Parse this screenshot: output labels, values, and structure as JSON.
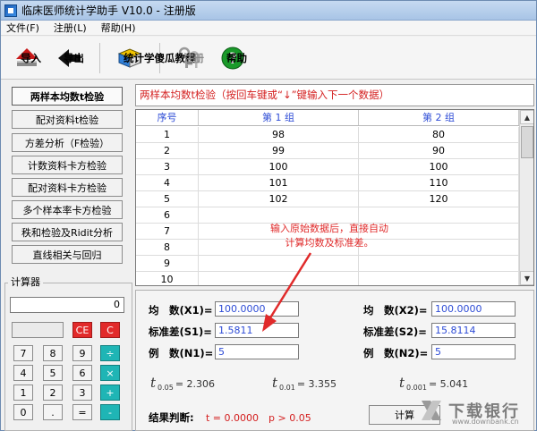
{
  "window": {
    "title": "临床医师统计学助手 V10.0 - 注册版"
  },
  "menu": {
    "file": "文件(F)",
    "register": "注册(L)",
    "help": "帮助(H)"
  },
  "toolbar": {
    "import": "导入",
    "export": "导出",
    "tutorial": "统计学傻瓜教程",
    "register": "注册",
    "help": "帮助"
  },
  "sidebar": {
    "items": [
      {
        "label": "两样本均数t检验",
        "active": true
      },
      {
        "label": "配对资料t检验"
      },
      {
        "label": "方差分析（F检验）"
      },
      {
        "label": "计数资料卡方检验"
      },
      {
        "label": "配对资料卡方检验"
      },
      {
        "label": "多个样本率卡方检验"
      },
      {
        "label": "秩和检验及Ridit分析"
      },
      {
        "label": "直线相关与回归"
      }
    ]
  },
  "calculator": {
    "legend": "计算器",
    "display": "0",
    "keys": [
      "7",
      "8",
      "9",
      "÷",
      "4",
      "5",
      "6",
      "×",
      "1",
      "2",
      "3",
      "+",
      "0",
      ".",
      "=",
      "-"
    ],
    "ce": "CE",
    "c": "C"
  },
  "hint": "两样本均数t检验（按回车键或“↓”键输入下一个数据）",
  "table": {
    "headers": [
      "序号",
      "第 1 组",
      "第 2 组"
    ],
    "rows": [
      [
        "1",
        "98",
        "80"
      ],
      [
        "2",
        "99",
        "90"
      ],
      [
        "3",
        "100",
        "100"
      ],
      [
        "4",
        "101",
        "110"
      ],
      [
        "5",
        "102",
        "120"
      ],
      [
        "6",
        "",
        ""
      ],
      [
        "7",
        "",
        ""
      ],
      [
        "8",
        "",
        ""
      ],
      [
        "9",
        "",
        ""
      ],
      [
        "10",
        "",
        ""
      ]
    ]
  },
  "annotation": {
    "line1": "输入原始数据后，直接自动",
    "line2": "计算均数及标准差。"
  },
  "stats": {
    "mean1_label": "均　数(X1)=",
    "mean1": "100.0000",
    "mean2_label": "均　数(X2)=",
    "mean2": "100.0000",
    "sd1_label": "标准差(S1)=",
    "sd1": "1.5811",
    "sd2_label": "标准差(S2)=",
    "sd2": "15.8114",
    "n1_label": "例　数(N1)=",
    "n1": "5",
    "n2_label": "例　数(N2)=",
    "n2": "5",
    "t005_sub": "0.05",
    "t005": "= 2.306",
    "t001_sub": "0.01",
    "t001": "= 3.355",
    "t0001_sub": "0.001",
    "t0001": "= 5.041",
    "result_label": "结果判断:",
    "result": "t = 0.0000　p > 0.05",
    "calc_button": "计算"
  },
  "watermark": {
    "text": "下载银行",
    "sub": "www.downbank.cn"
  }
}
